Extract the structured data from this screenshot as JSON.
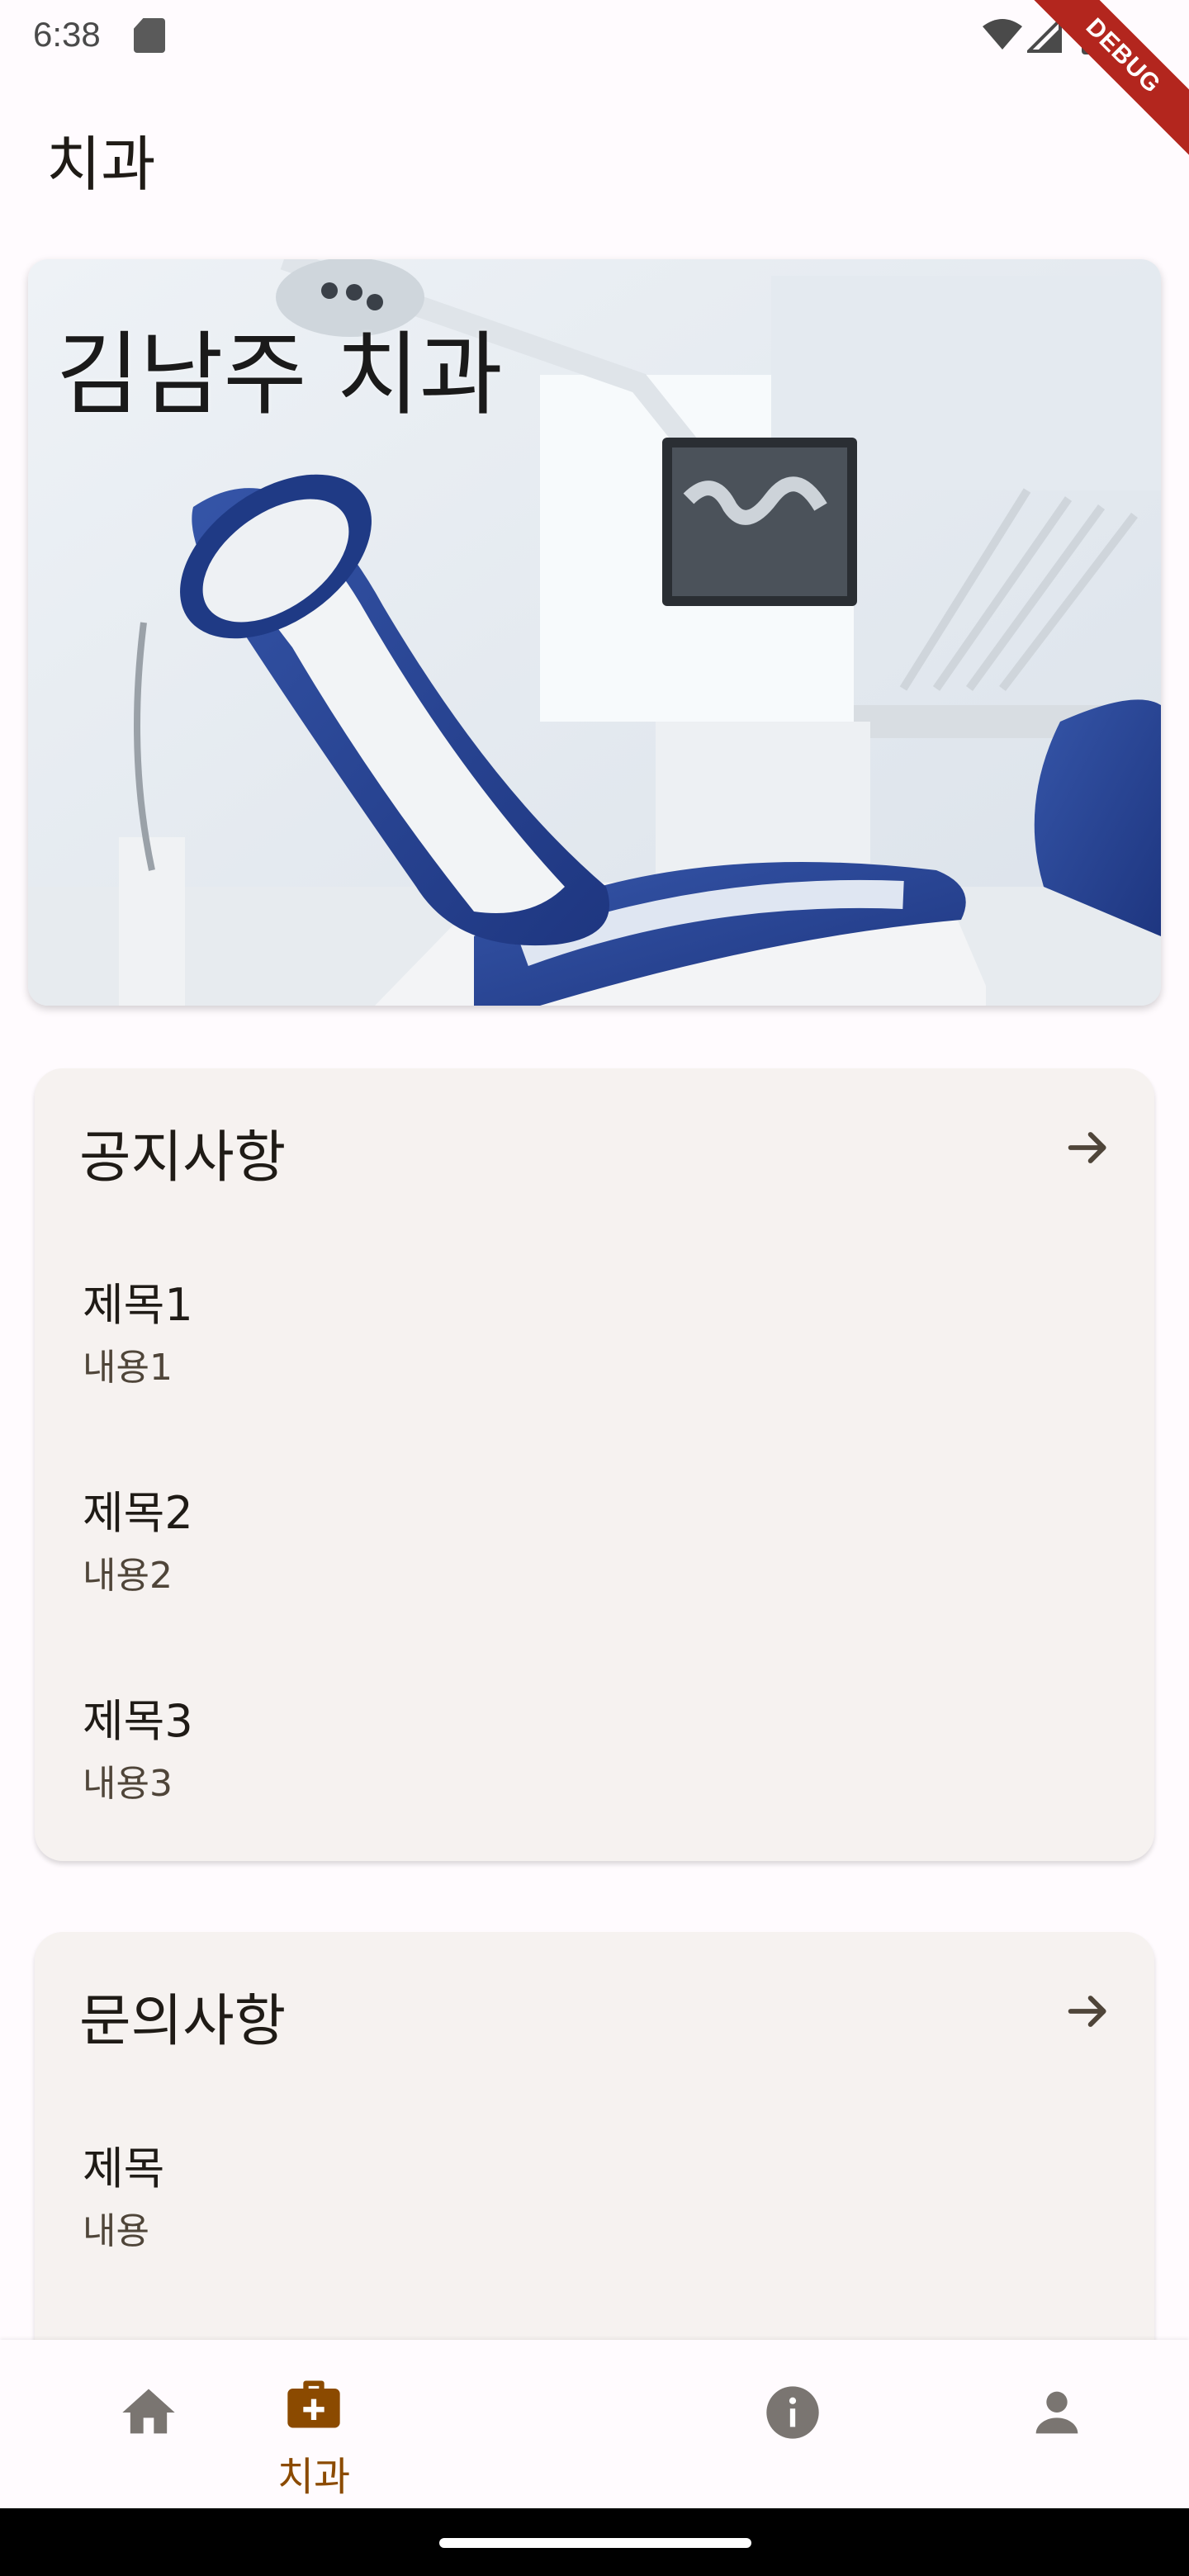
{
  "status_bar": {
    "time": "6:38",
    "debug_label": "DEBUG",
    "icons": [
      "sd-card-icon",
      "wifi-icon",
      "signal-icon",
      "battery-icon"
    ]
  },
  "app_bar": {
    "title": "치과"
  },
  "hero": {
    "title": "김남주 치과",
    "image": "dental-clinic-chair-photo"
  },
  "notice": {
    "header": "공지사항",
    "items": [
      {
        "title": "제목1",
        "body": "내용1"
      },
      {
        "title": "제목2",
        "body": "내용2"
      },
      {
        "title": "제목3",
        "body": "내용3"
      }
    ]
  },
  "inquiry": {
    "header": "문의사항",
    "items": [
      {
        "title": "제목",
        "body": "내용"
      }
    ]
  },
  "bottom_nav": {
    "items": [
      {
        "icon": "home-icon",
        "label": ""
      },
      {
        "icon": "medical-bag-icon",
        "label": "치과",
        "selected": true
      },
      {
        "icon": "info-icon",
        "label": ""
      },
      {
        "icon": "person-icon",
        "label": ""
      }
    ]
  },
  "colors": {
    "accent": "#8b4a00",
    "card_bg": "#f6f2f0",
    "background": "#fffbfe",
    "icon_inactive": "#7a7571"
  }
}
